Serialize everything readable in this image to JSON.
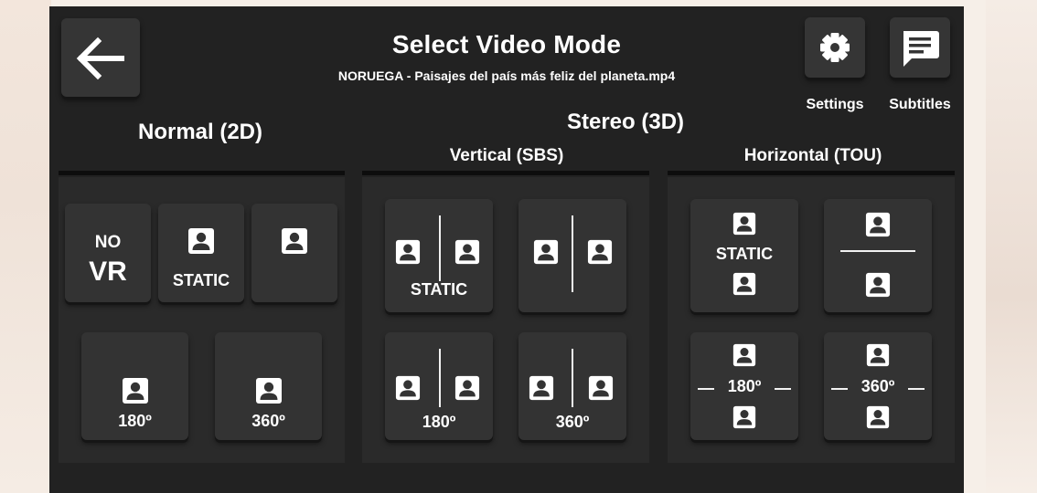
{
  "header": {
    "title": "Select Video Mode",
    "filename": "NORUEGA - Paisajes del país más feliz del planeta.mp4",
    "back_icon": "arrow-left-icon",
    "settings_label": "Settings",
    "settings_icon": "gear-icon",
    "subtitles_label": "Subtitles",
    "subtitles_icon": "subtitles-icon"
  },
  "sections": {
    "normal_title": "Normal (2D)",
    "stereo_title": "Stereo (3D)",
    "vertical_title": "Vertical (SBS)",
    "horizontal_title": "Horizontal (TOU)"
  },
  "normal": {
    "novr_line1": "NO",
    "novr_line2": "VR",
    "static_label": "STATIC",
    "d180_label": "180º",
    "d360_label": "360º"
  },
  "sbs": {
    "static_label": "STATIC",
    "d180_label": "180º",
    "d360_label": "360º"
  },
  "tou": {
    "static_label": "STATIC",
    "d180_label": "180º",
    "d360_label": "360º"
  },
  "colors": {
    "panel": "#222222",
    "button": "#333333",
    "text": "#ffffff"
  }
}
